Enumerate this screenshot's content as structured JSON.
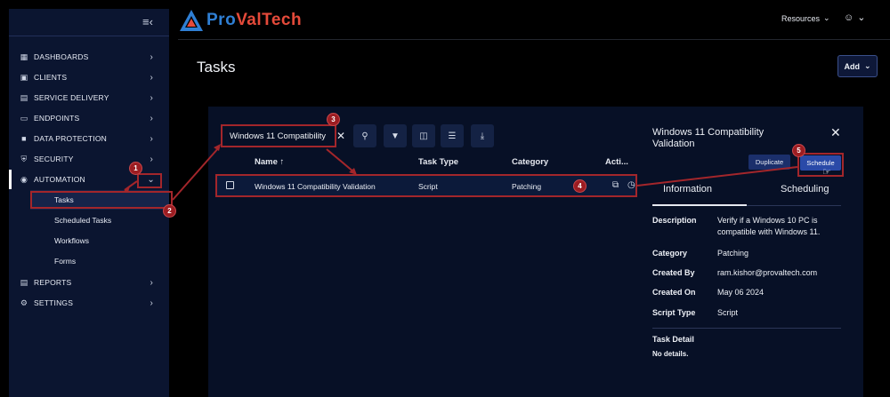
{
  "brand": {
    "part1": "Pro",
    "part2": "ValTech"
  },
  "header": {
    "resources_label": "Resources"
  },
  "sidebar": {
    "items": [
      {
        "label": "DASHBOARDS",
        "icon": "grid-icon"
      },
      {
        "label": "CLIENTS",
        "icon": "building-icon"
      },
      {
        "label": "SERVICE DELIVERY",
        "icon": "ticket-icon"
      },
      {
        "label": "ENDPOINTS",
        "icon": "monitor-icon"
      },
      {
        "label": "DATA PROTECTION",
        "icon": "lock-icon"
      },
      {
        "label": "SECURITY",
        "icon": "shield-icon"
      },
      {
        "label": "AUTOMATION",
        "icon": "robot-icon"
      },
      {
        "label": "REPORTS",
        "icon": "report-icon"
      },
      {
        "label": "SETTINGS",
        "icon": "gear-icon"
      }
    ],
    "automation_sub": [
      "Tasks",
      "Scheduled Tasks",
      "Workflows",
      "Forms"
    ]
  },
  "page": {
    "title": "Tasks",
    "add_label": "Add"
  },
  "search": {
    "value": "Windows 11 Compatibility"
  },
  "table": {
    "columns": [
      "Name",
      "Task Type",
      "Category",
      "Acti..."
    ],
    "rows": [
      {
        "name": "Windows 11 Compatibility Validation",
        "type": "Script",
        "category": "Patching"
      }
    ]
  },
  "detail": {
    "title": "Windows 11 Compatibility Validation",
    "duplicate_label": "Duplicate",
    "schedule_label": "Schedule",
    "tabs": [
      "Information",
      "Scheduling"
    ],
    "fields": [
      {
        "label": "Description",
        "value": "Verify if a Windows 10 PC is compatible with Windows 11."
      },
      {
        "label": "Category",
        "value": "Patching"
      },
      {
        "label": "Created By",
        "value": "ram.kishor@provaltech.com"
      },
      {
        "label": "Created On",
        "value": "May 06 2024"
      },
      {
        "label": "Script Type",
        "value": "Script"
      }
    ],
    "task_detail_label": "Task Detail",
    "task_detail_value": "No details."
  },
  "annotations": [
    "1",
    "2",
    "3",
    "4",
    "5"
  ],
  "colors": {
    "accent_red": "#a3262b",
    "brand_blue": "#2f7fd4",
    "brand_red": "#e54a3a"
  }
}
